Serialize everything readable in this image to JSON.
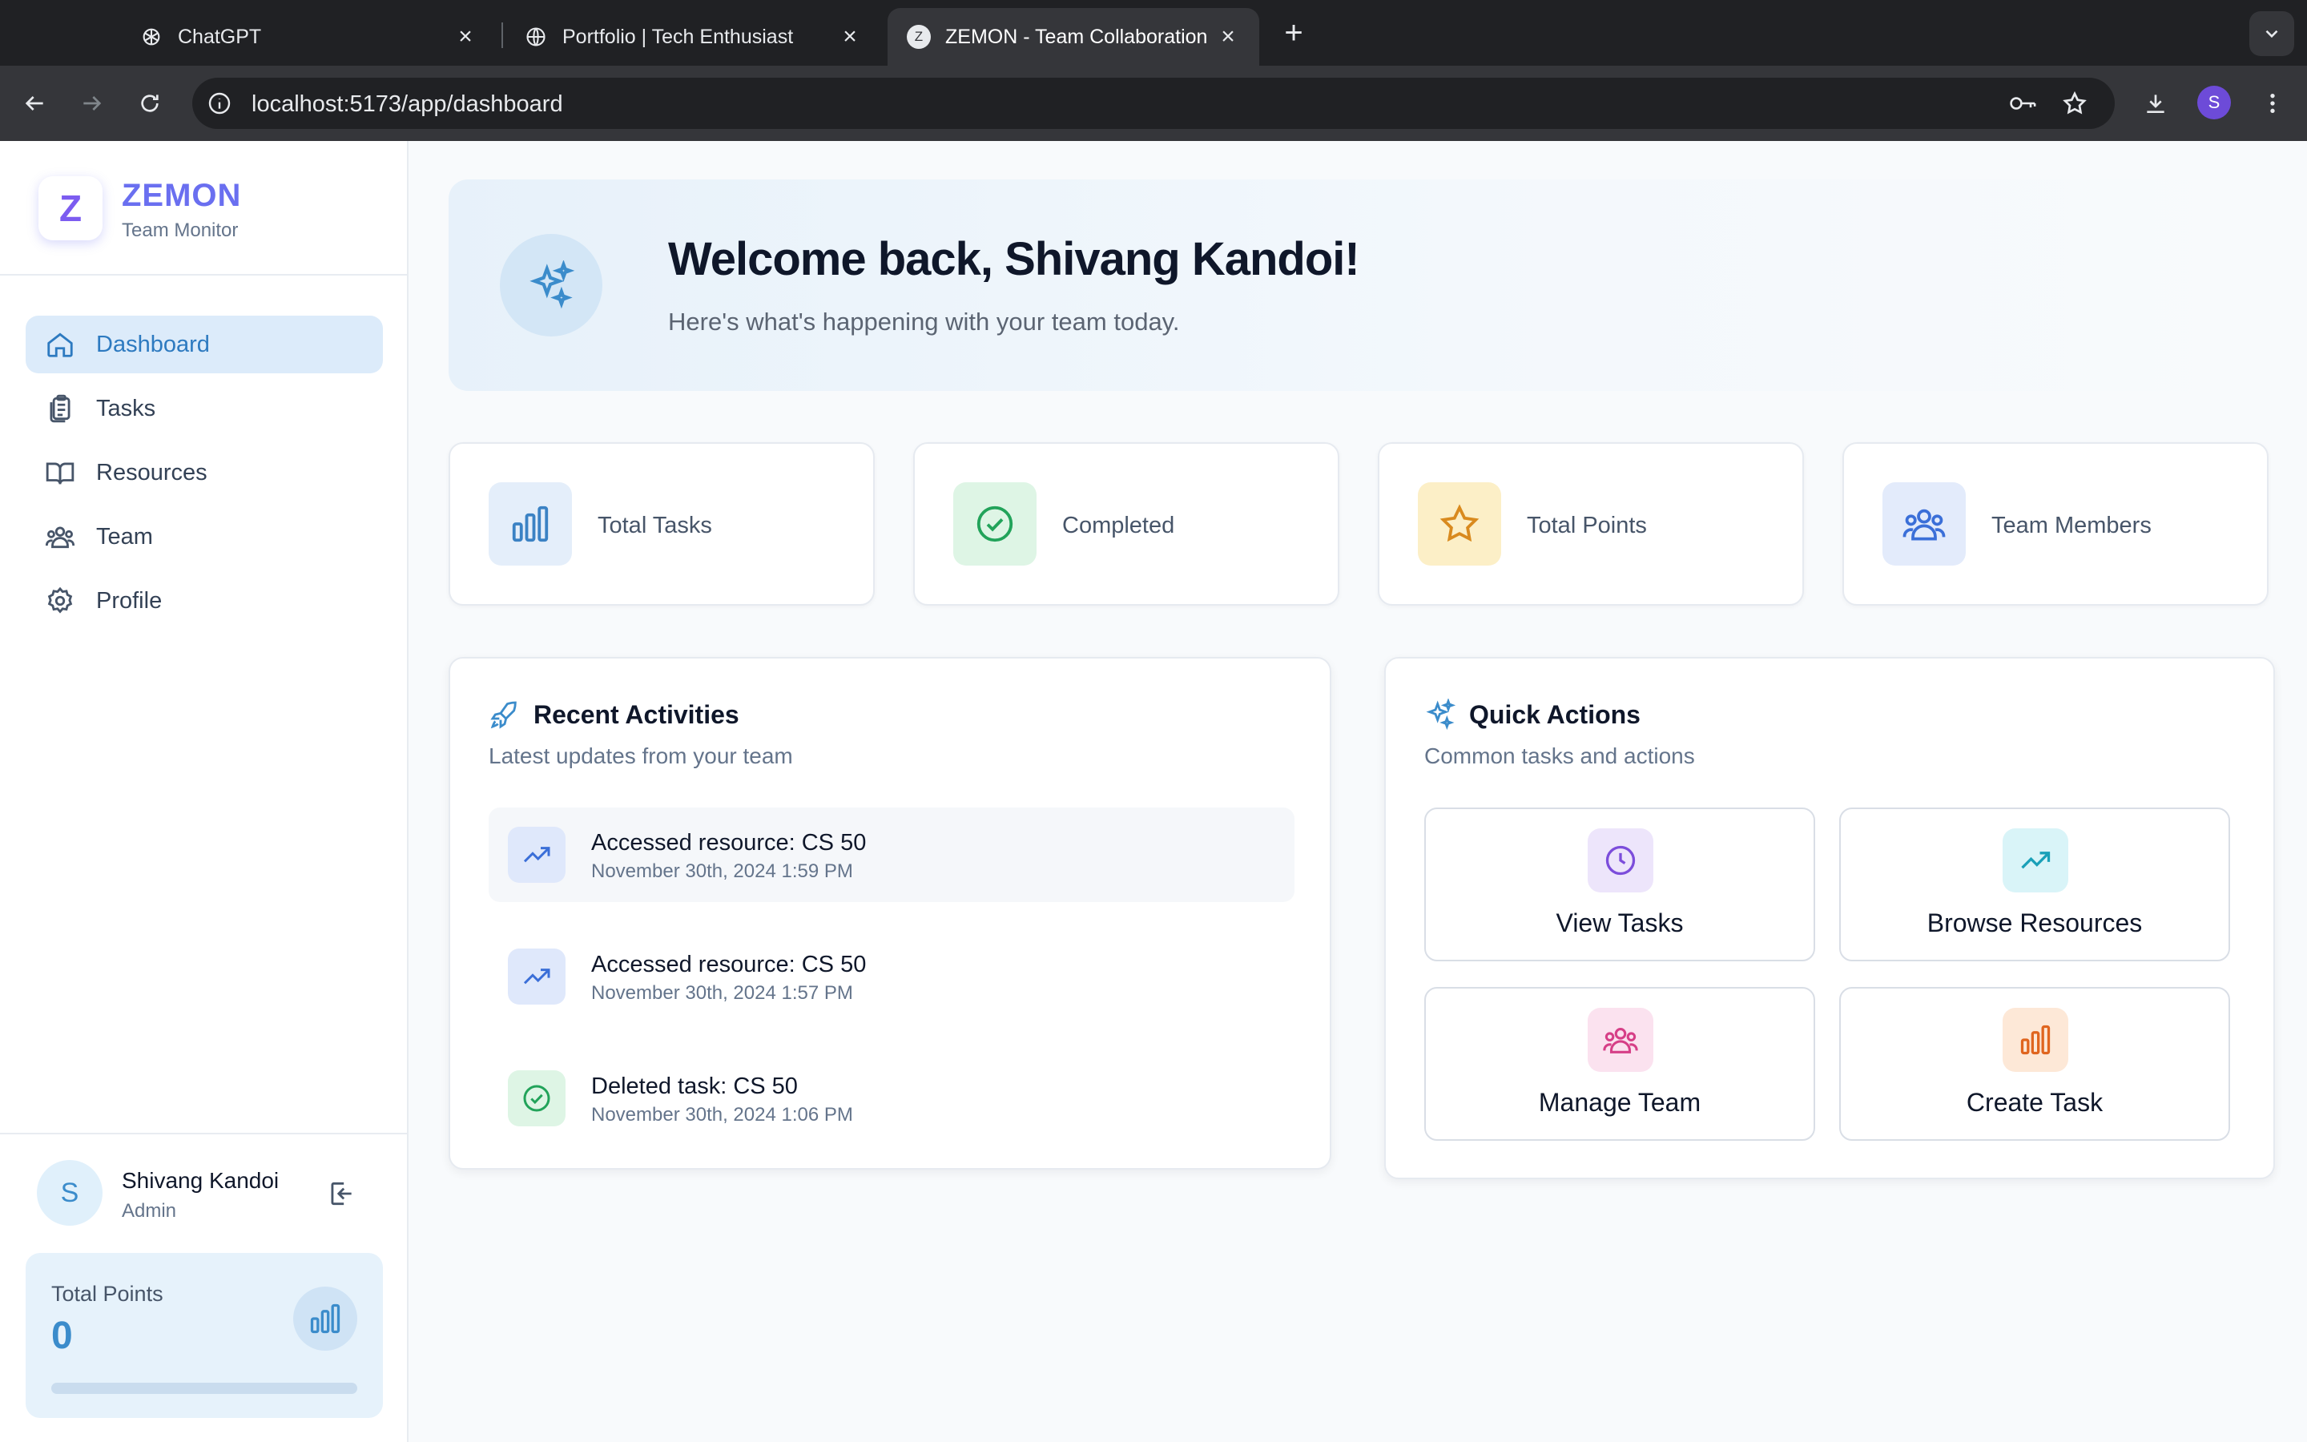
{
  "browser": {
    "tabs": [
      {
        "title": "ChatGPT",
        "active": false
      },
      {
        "title": "Portfolio | Tech Enthusiast",
        "active": false
      },
      {
        "title": "ZEMON - Team Collaboration",
        "active": true
      }
    ],
    "url": "localhost:5173/app/dashboard",
    "profile_initial": "S"
  },
  "sidebar": {
    "brand": {
      "logo_letter": "Z",
      "name": "ZEMON",
      "subtitle": "Team Monitor"
    },
    "nav": [
      {
        "label": "Dashboard",
        "icon": "home-icon",
        "active": true
      },
      {
        "label": "Tasks",
        "icon": "clipboard-icon",
        "active": false
      },
      {
        "label": "Resources",
        "icon": "book-icon",
        "active": false
      },
      {
        "label": "Team",
        "icon": "users-icon",
        "active": false
      },
      {
        "label": "Profile",
        "icon": "gear-icon",
        "active": false
      }
    ],
    "user": {
      "initial": "S",
      "name": "Shivang Kandoi",
      "role": "Admin"
    },
    "points": {
      "label": "Total Points",
      "value": "0",
      "progress": 0
    }
  },
  "main": {
    "hero": {
      "title": "Welcome back, Shivang Kandoi!",
      "subtitle": "Here's what's happening with your team today."
    },
    "stats": [
      {
        "label": "Total Tasks",
        "icon": "bar-chart-icon",
        "color": "#3b82c4"
      },
      {
        "label": "Completed",
        "icon": "check-circle-icon",
        "color": "#22a35a"
      },
      {
        "label": "Total Points",
        "icon": "star-icon",
        "color": "#d98a1e"
      },
      {
        "label": "Team Members",
        "icon": "users-icon",
        "color": "#3b6fd8"
      }
    ],
    "recent": {
      "title": "Recent Activities",
      "subtitle": "Latest updates from your team",
      "items": [
        {
          "title": "Accessed resource: CS 50",
          "time": "November 30th, 2024 1:59 PM",
          "icon": "trending-up-icon"
        },
        {
          "title": "Accessed resource: CS 50",
          "time": "November 30th, 2024 1:57 PM",
          "icon": "trending-up-icon"
        },
        {
          "title": "Deleted task: CS 50",
          "time": "November 30th, 2024 1:06 PM",
          "icon": "check-circle-icon"
        }
      ]
    },
    "quick": {
      "title": "Quick Actions",
      "subtitle": "Common tasks and actions",
      "actions": [
        {
          "label": "View Tasks",
          "icon": "clock-icon",
          "color": "#7c4ddb"
        },
        {
          "label": "Browse Resources",
          "icon": "trending-up-icon",
          "color": "#1aa0b8"
        },
        {
          "label": "Manage Team",
          "icon": "users-icon",
          "color": "#d63f87"
        },
        {
          "label": "Create Task",
          "icon": "bar-chart-icon",
          "color": "#e0651f"
        }
      ]
    }
  }
}
